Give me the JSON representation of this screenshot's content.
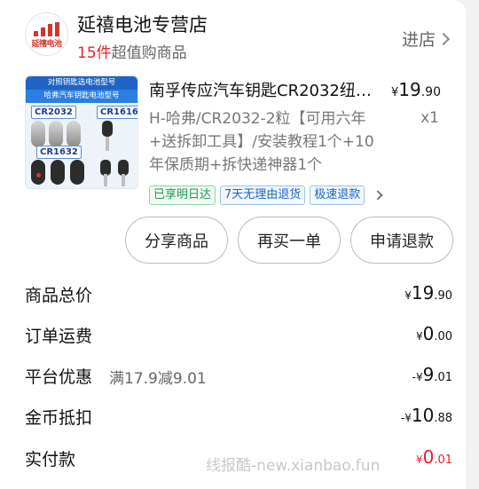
{
  "shop": {
    "logo_text": "延禧电池",
    "name": "延禧电池专营店",
    "count": "15件",
    "sub_suffix": "超值购商品",
    "enter_label": "进店"
  },
  "product": {
    "thumb": {
      "banner1": "对照钥匙选电池型号",
      "banner2": "哈弗汽车钥匙电池型号",
      "label_cr2032": "CR2032",
      "label_cr1616": "CR1616",
      "label_cr1632": "CR1632"
    },
    "title": "南孚传应汽车钥匙CR2032纽…",
    "price_cur": "¥",
    "price_int": "19",
    "price_dec": ".90",
    "spec": "H-哈弗/CR2032-2粒【可用六年+送拆卸工具】/安装教程1个+10年保质期+拆快递神器1个",
    "qty": "x1",
    "tags": [
      "已享明日达",
      "7天无理由退货",
      "极速退款"
    ]
  },
  "actions": {
    "share": "分享商品",
    "rebuy": "再买一单",
    "refund": "申请退款"
  },
  "summary": {
    "total": {
      "label": "商品总价",
      "cur": "¥",
      "int": "19",
      "dec": ".90"
    },
    "shipping": {
      "label": "订单运费",
      "cur": "¥",
      "int": "0",
      "dec": ".00"
    },
    "discount": {
      "label": "平台优惠",
      "note": "满17.9减9.01",
      "cur": "-¥",
      "int": "9",
      "dec": ".01"
    },
    "coins": {
      "label": "金币抵扣",
      "cur": "-¥",
      "int": "10",
      "dec": ".88"
    },
    "paid": {
      "label": "实付款",
      "cur": "¥",
      "int": "0",
      "dec": ".01"
    }
  },
  "colors": {
    "accent_red": "#e8202e",
    "tag_green": "#1c9a4b",
    "tag_blue": "#1b63c6"
  },
  "watermark": "线报酷-new.xianbao.fun"
}
